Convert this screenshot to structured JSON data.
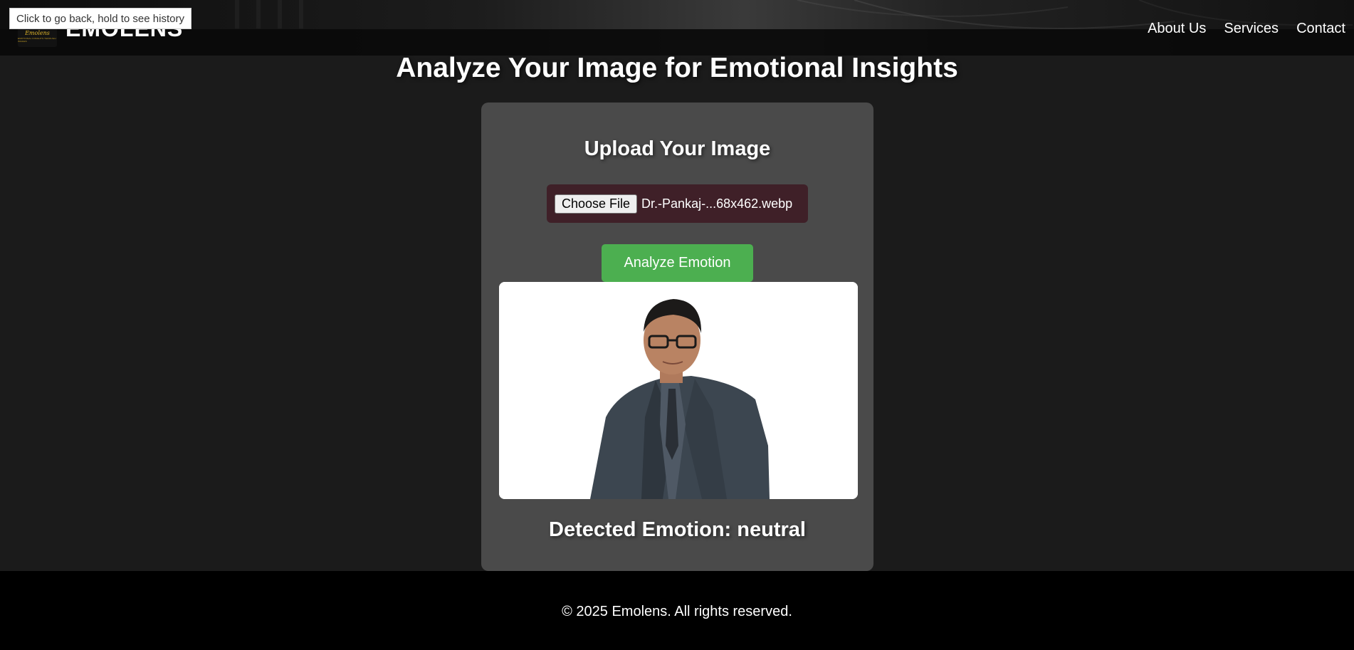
{
  "browser": {
    "back_tooltip": "Click to go back, hold to see history"
  },
  "header": {
    "logo_word": "Emolens",
    "logo_tagline": "EMOTIONAL INSIGHTS THROUGH IMAGES",
    "brand": "EMOLENS",
    "nav": [
      "About Us",
      "Services",
      "Contact"
    ]
  },
  "main": {
    "title": "Analyze Your Image for Emotional Insights",
    "upload_title": "Upload Your Image",
    "choose_file_label": "Choose File",
    "file_name": "Dr.-Pankaj-...68x462.webp",
    "analyze_button": "Analyze Emotion",
    "result_label": "Detected Emotion: neutral"
  },
  "footer": {
    "copyright": "© 2025 Emolens. All rights reserved."
  },
  "colors": {
    "page_background": "#1b1b1b",
    "card_background": "#4a4a4a",
    "file_box_background": "#3f2028",
    "accent_green": "#4caf50",
    "footer_background": "#000000",
    "logo_gold": "#e0b62a"
  }
}
